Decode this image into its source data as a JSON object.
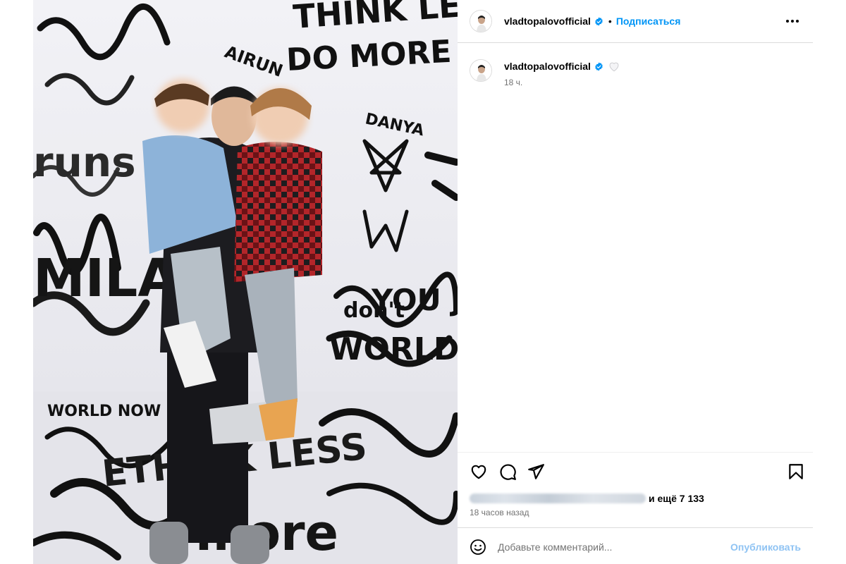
{
  "post": {
    "photo_description_icon": "photo-image",
    "wall_graffiti": [
      "THINK LESS.",
      "DO MORE",
      "DANYA",
      "runs",
      "don't",
      "YOU JUS",
      "WORLD",
      "AIRUN",
      "MILA",
      "more",
      "ETHINK LESS",
      "WORLD NOW"
    ],
    "header": {
      "username": "vladtopalovofficial",
      "verified_icon": "verified-badge-icon",
      "separator": "•",
      "follow_label": "Подписаться",
      "more_icon": "more-options-icon"
    },
    "caption": {
      "username": "vladtopalovofficial",
      "verified_icon": "verified-badge-icon",
      "emoji": "white-heart",
      "time": "18 ч."
    },
    "actions": {
      "like_icon": "heart-outline-icon",
      "comment_icon": "comment-bubble-icon",
      "share_icon": "paper-plane-icon",
      "save_icon": "bookmark-icon"
    },
    "likes": {
      "more_text": "и ещё 7 133"
    },
    "date": "18 часов назад",
    "comment": {
      "emoji_icon": "smiley-face-icon",
      "placeholder": "Добавьте комментарий...",
      "publish_label": "Опубликовать"
    },
    "colors": {
      "accent": "#0095f6",
      "publish_disabled": "#8fc3f3",
      "secondary_text": "#737373",
      "border": "#dbdbdb",
      "verified": "#0095f6"
    }
  }
}
